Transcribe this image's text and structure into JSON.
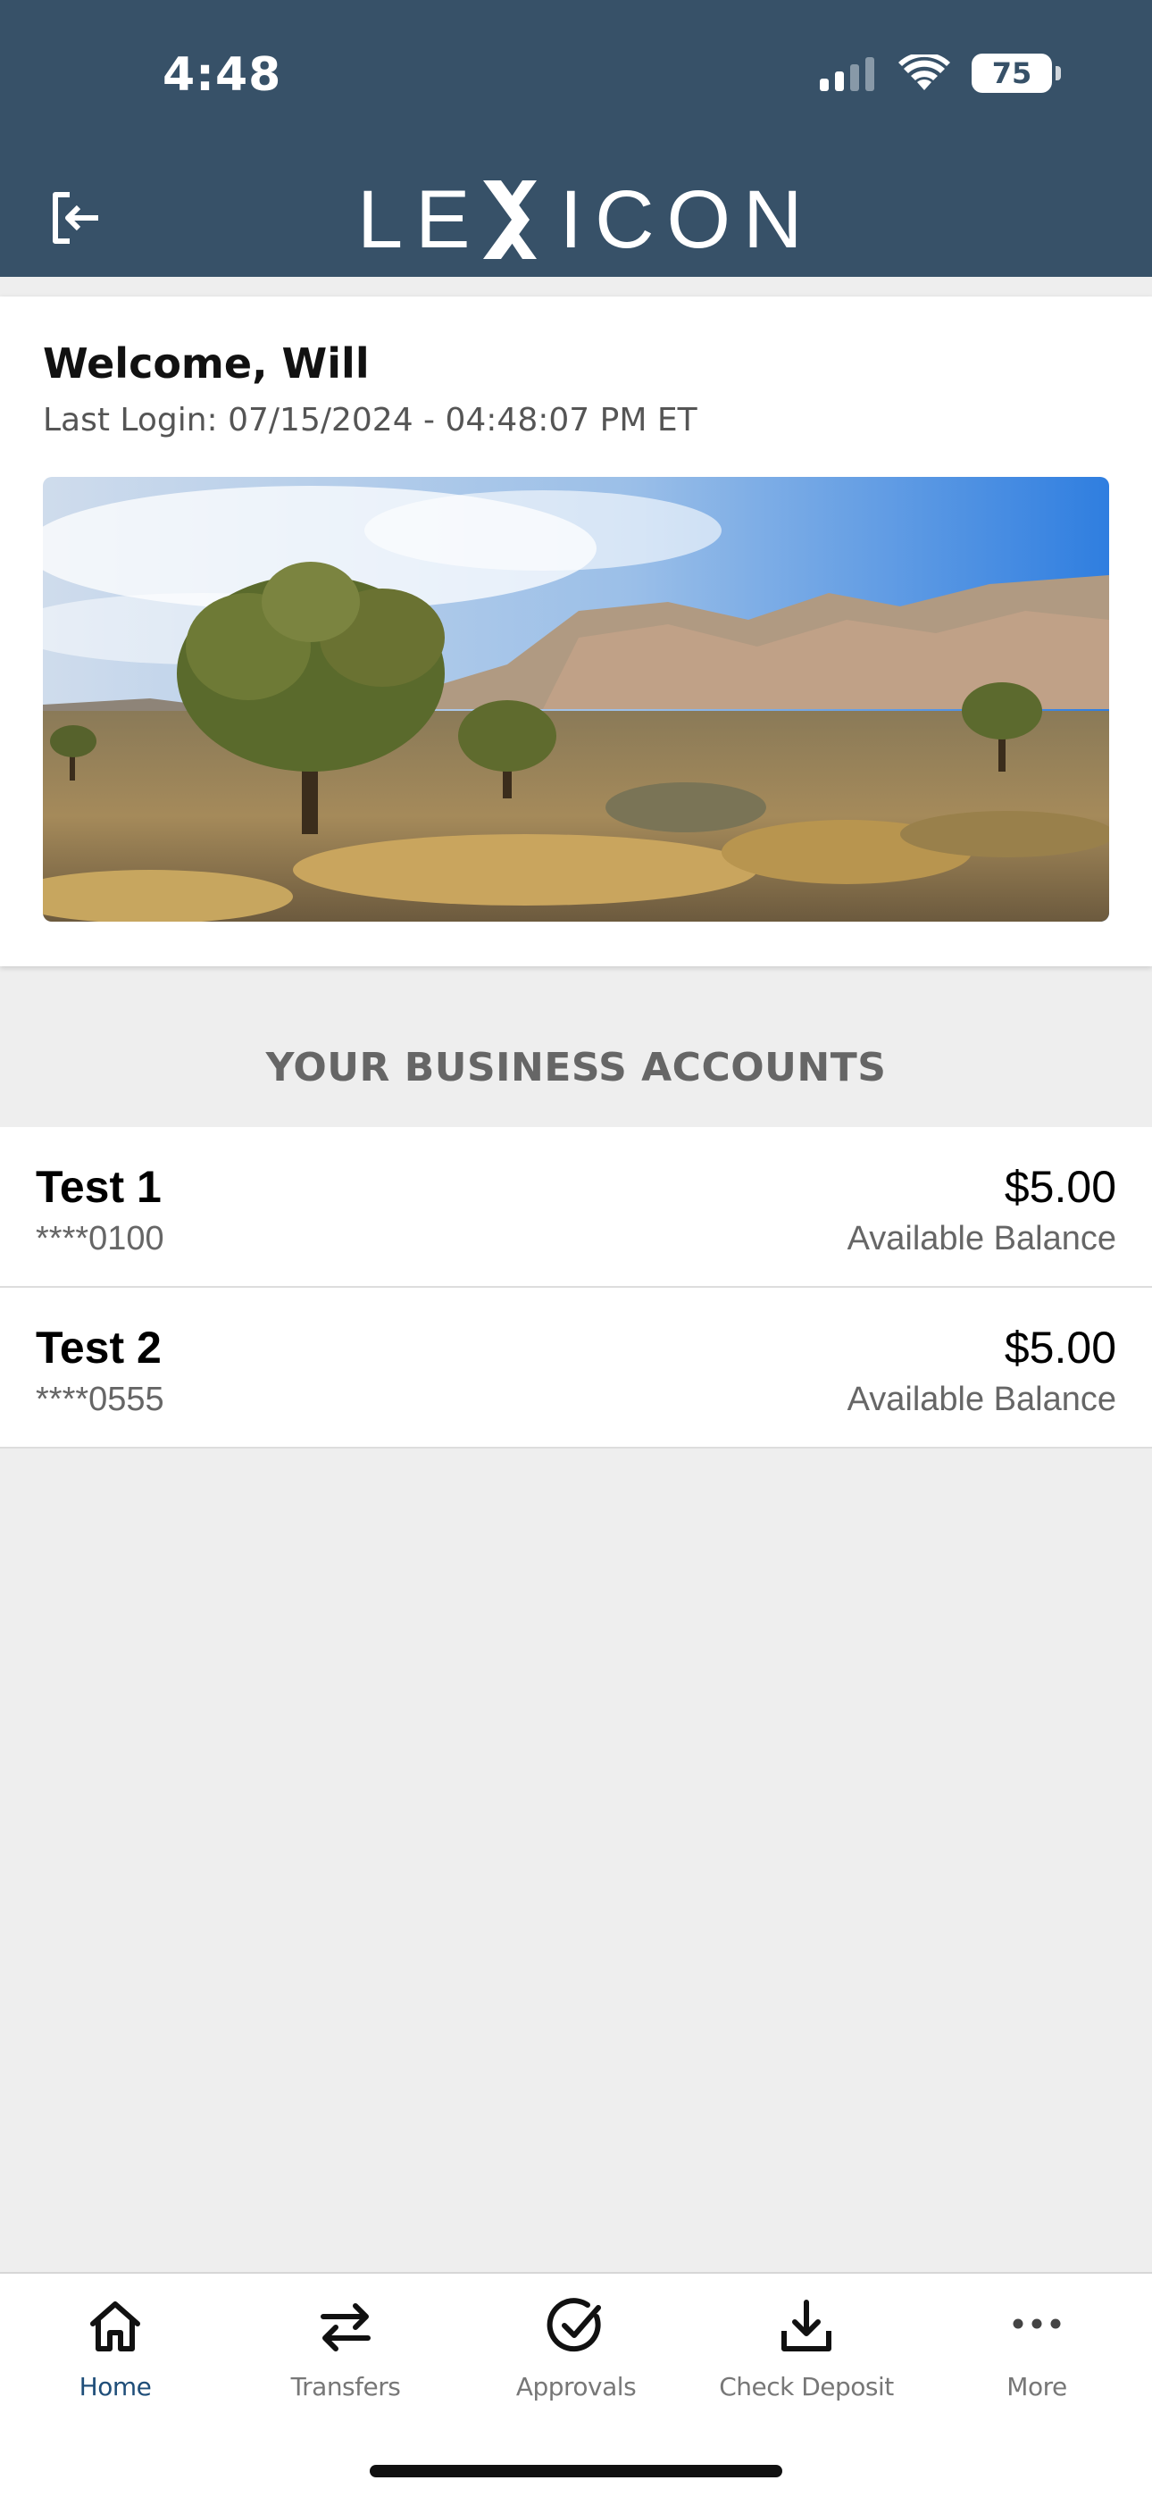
{
  "status_bar": {
    "time": "4:48",
    "battery": "75"
  },
  "header": {
    "logo_text_left": "LE",
    "logo_text_right": "ICON"
  },
  "welcome": {
    "title": "Welcome, Will",
    "last_login": "Last Login: 07/15/2024 - 04:48:07 PM ET"
  },
  "accounts_section": {
    "title": "YOUR BUSINESS ACCOUNTS",
    "accounts": [
      {
        "name": "Test 1",
        "number": "****0100",
        "balance": "$5.00",
        "balance_label": "Available Balance"
      },
      {
        "name": "Test 2",
        "number": "****0555",
        "balance": "$5.00",
        "balance_label": "Available Balance"
      }
    ]
  },
  "bottom_nav": {
    "items": [
      {
        "label": "Home",
        "icon": "home-icon",
        "active": true
      },
      {
        "label": "Transfers",
        "icon": "transfer-arrows-icon"
      },
      {
        "label": "Approvals",
        "icon": "check-circle-icon"
      },
      {
        "label": "Check Deposit",
        "icon": "download-tray-icon"
      },
      {
        "label": "More",
        "icon": "ellipsis-icon"
      }
    ]
  },
  "colors": {
    "header_bg": "#375168",
    "active_nav": "#1f4e79",
    "page_bg": "#eeeeee"
  }
}
